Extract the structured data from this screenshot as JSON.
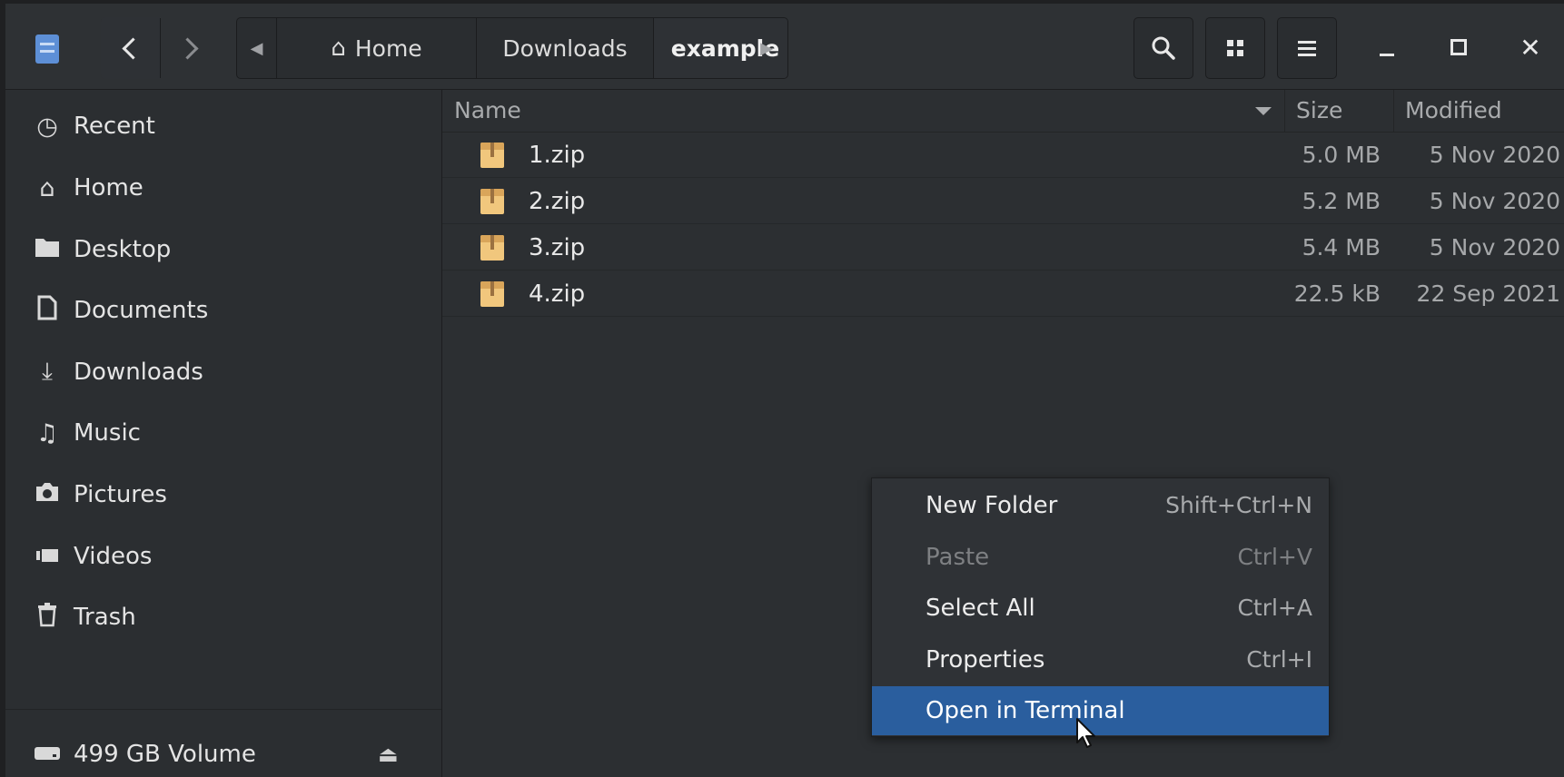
{
  "header": {
    "path": [
      "Home",
      "Downloads",
      "example"
    ]
  },
  "sidebar": {
    "items": [
      {
        "label": "Recent",
        "icon": "clock-icon"
      },
      {
        "label": "Home",
        "icon": "home-icon"
      },
      {
        "label": "Desktop",
        "icon": "folder-icon"
      },
      {
        "label": "Documents",
        "icon": "document-icon"
      },
      {
        "label": "Downloads",
        "icon": "download-icon"
      },
      {
        "label": "Music",
        "icon": "music-icon"
      },
      {
        "label": "Pictures",
        "icon": "camera-icon"
      },
      {
        "label": "Videos",
        "icon": "video-icon"
      },
      {
        "label": "Trash",
        "icon": "trash-icon"
      }
    ],
    "volume": {
      "label": "499 GB Volume",
      "icon": "drive-icon"
    }
  },
  "list": {
    "columns": {
      "name": "Name",
      "size": "Size",
      "modified": "Modified"
    },
    "rows": [
      {
        "name": "1.zip",
        "size": "5.0 MB",
        "modified": "5 Nov 2020"
      },
      {
        "name": "2.zip",
        "size": "5.2 MB",
        "modified": "5 Nov 2020"
      },
      {
        "name": "3.zip",
        "size": "5.4 MB",
        "modified": "5 Nov 2020"
      },
      {
        "name": "4.zip",
        "size": "22.5 kB",
        "modified": "22 Sep 2021"
      }
    ]
  },
  "context_menu": {
    "items": [
      {
        "label": "New Folder",
        "accel": "Shift+Ctrl+N",
        "state": "enabled"
      },
      {
        "label": "Paste",
        "accel": "Ctrl+V",
        "state": "disabled"
      },
      {
        "label": "Select All",
        "accel": "Ctrl+A",
        "state": "enabled"
      },
      {
        "label": "Properties",
        "accel": "Ctrl+I",
        "state": "enabled"
      },
      {
        "label": "Open in Terminal",
        "accel": "",
        "state": "highlighted"
      }
    ]
  },
  "colors": {
    "highlight": "#2a5e9e",
    "background": "#2b2e31",
    "folder_icon": "#f1c77d"
  }
}
